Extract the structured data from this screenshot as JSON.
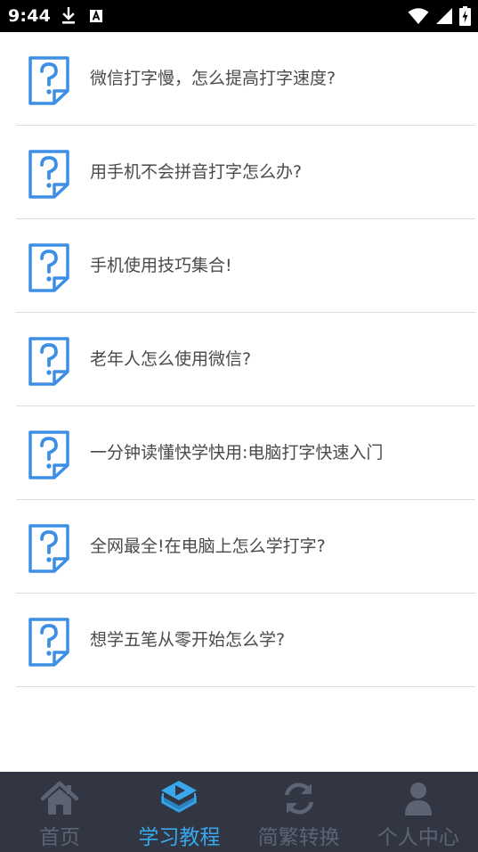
{
  "status_bar": {
    "time": "9:44",
    "left_icons": [
      "download-icon",
      "a-box-icon"
    ],
    "right_icons": [
      "wifi-icon",
      "signal-icon",
      "battery-charging-icon"
    ]
  },
  "list": {
    "icon": "question-document-icon",
    "items": [
      {
        "title": "微信打字慢，怎么提高打字速度?"
      },
      {
        "title": "用手机不会拼音打字怎么办?"
      },
      {
        "title": "手机使用技巧集合!"
      },
      {
        "title": "老年人怎么使用微信?"
      },
      {
        "title": "一分钟读懂快学快用:电脑打字快速入门"
      },
      {
        "title": "全网最全!在电脑上怎么学打字?"
      },
      {
        "title": "想学五笔从零开始怎么学?"
      }
    ]
  },
  "tab_bar": {
    "colors": {
      "active": "#38a7eb",
      "inactive": "#5d6372",
      "background": "#323642"
    },
    "tabs": [
      {
        "label": "首页",
        "icon": "home-icon",
        "active": false
      },
      {
        "label": "学习教程",
        "icon": "tutorial-play-icon",
        "active": true
      },
      {
        "label": "简繁转换",
        "icon": "convert-refresh-icon",
        "active": false
      },
      {
        "label": "个人中心",
        "icon": "user-icon",
        "active": false
      }
    ]
  }
}
